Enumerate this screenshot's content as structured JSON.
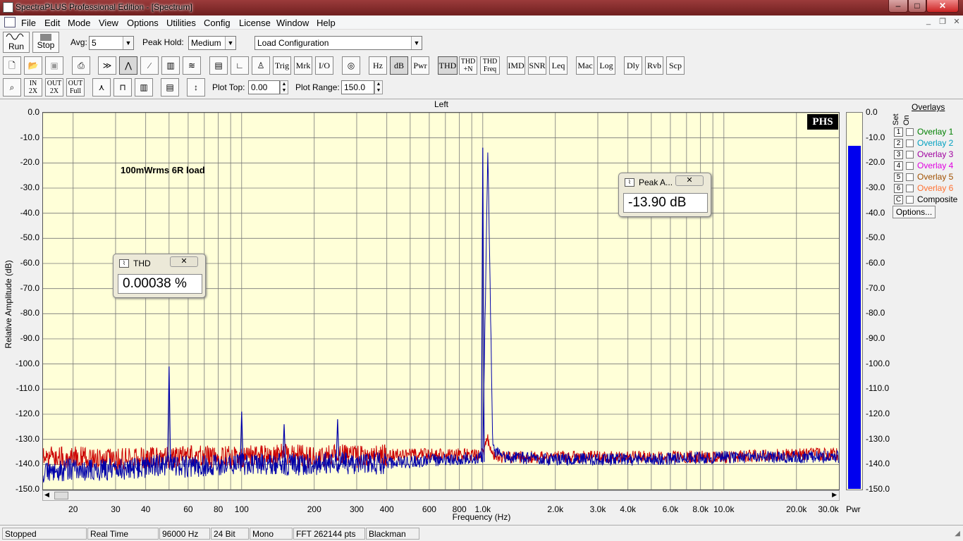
{
  "window": {
    "title": "SpectraPLUS Professional Edition - [Spectrum]",
    "minimize": "–",
    "maximize": "□",
    "close": "✕"
  },
  "menu": [
    "File",
    "Edit",
    "Mode",
    "View",
    "Options",
    "Utilities",
    "Config",
    "License",
    "Window",
    "Help"
  ],
  "controls": {
    "run_label": "Run",
    "stop_label": "Stop",
    "avg_label": "Avg:",
    "avg_value": "5",
    "peakhold_label": "Peak Hold:",
    "peakhold_value": "Medium",
    "config_value": "Load Configuration",
    "plottop_label": "Plot Top:",
    "plottop_value": "0.00",
    "plotrange_label": "Plot Range:",
    "plotrange_value": "150.0"
  },
  "toolbar2": [
    {
      "name": "trig",
      "label": "Trig"
    },
    {
      "name": "mrk",
      "label": "Mrk"
    },
    {
      "name": "io",
      "label": "I/O"
    },
    {
      "name": "hz",
      "label": "Hz"
    },
    {
      "name": "db",
      "label": "dB"
    },
    {
      "name": "pwr",
      "label": "Pwr"
    },
    {
      "name": "thd",
      "label": "THD"
    },
    {
      "name": "thdn",
      "label": "THD +N"
    },
    {
      "name": "thdfreq",
      "label": "THD Freq"
    },
    {
      "name": "imd",
      "label": "IMD"
    },
    {
      "name": "snr",
      "label": "SNR"
    },
    {
      "name": "leq",
      "label": "Leq"
    },
    {
      "name": "mac",
      "label": "Mac"
    },
    {
      "name": "log",
      "label": "Log"
    },
    {
      "name": "dly",
      "label": "Dly"
    },
    {
      "name": "rvb",
      "label": "Rvb"
    },
    {
      "name": "scp",
      "label": "Scp"
    }
  ],
  "toolbar3": [
    {
      "name": "zoom-in-2x",
      "label": "IN 2X"
    },
    {
      "name": "zoom-out-2x",
      "label": "OUT 2X"
    },
    {
      "name": "zoom-out-full",
      "label": "OUT Full"
    }
  ],
  "plot": {
    "channel": "Left",
    "annotation": "100mWrms 6R load",
    "logo": "PHS",
    "ylabel": "Relative Amplitude (dB)",
    "xlabel": "Frequency (Hz)",
    "yticks": [
      "0.0",
      "-10.0",
      "-20.0",
      "-30.0",
      "-40.0",
      "-50.0",
      "-60.0",
      "-70.0",
      "-80.0",
      "-90.0",
      "-100.0",
      "-110.0",
      "-120.0",
      "-130.0",
      "-140.0",
      "-150.0"
    ],
    "xticks": [
      "20",
      "30",
      "40",
      "60",
      "80",
      "100",
      "200",
      "300",
      "400",
      "600",
      "800",
      "1.0k",
      "2.0k",
      "3.0k",
      "4.0k",
      "6.0k",
      "8.0k",
      "10.0k",
      "20.0k",
      "30.0k"
    ],
    "power_ticks": [
      "0.0",
      "-10.0",
      "-20.0",
      "-30.0",
      "-40.0",
      "-50.0",
      "-60.0",
      "-70.0",
      "-80.0",
      "-90.0",
      "-100.0",
      "-110.0",
      "-120.0",
      "-130.0",
      "-140.0",
      "-150.0"
    ],
    "power_label": "Pwr"
  },
  "chart_data": {
    "type": "line",
    "title": "Left",
    "xlabel": "Frequency (Hz)",
    "ylabel": "Relative Amplitude (dB)",
    "xscale": "log",
    "xlim": [
      15,
      30000
    ],
    "ylim": [
      -150,
      0
    ],
    "grid": true,
    "series": [
      {
        "color": "#cc0000",
        "x": [
          15,
          20,
          30,
          50,
          60,
          100,
          150,
          200,
          250,
          300,
          500,
          1000,
          1050,
          1100,
          1200,
          2000,
          3000,
          5000,
          10000,
          20000,
          30000
        ],
        "values": [
          -137,
          -137,
          -138,
          -137,
          -137,
          -137,
          -136,
          -137,
          -136,
          -137,
          -136,
          -136,
          -130,
          -136,
          -137,
          -137,
          -137,
          -137,
          -137,
          -136,
          -136
        ]
      },
      {
        "color": "#0000aa",
        "x": [
          15,
          20,
          30,
          50,
          60,
          100,
          150,
          200,
          250,
          300,
          500,
          1000,
          1050,
          1100,
          1200,
          2000,
          3000,
          5000,
          10000,
          20000,
          30000
        ],
        "values": [
          -143,
          -142,
          -142,
          -140,
          -141,
          -140,
          -140,
          -140,
          -139,
          -140,
          -139,
          -137,
          -14,
          -134,
          -137,
          -138,
          -138,
          -138,
          -137,
          -137,
          -137
        ]
      }
    ],
    "peaks": [
      {
        "x": 50,
        "y": -101
      },
      {
        "x": 100,
        "y": -119
      },
      {
        "x": 150,
        "y": -124
      },
      {
        "x": 250,
        "y": -122
      },
      {
        "x": 1000,
        "y": -13.9
      }
    ],
    "power_level": -13
  },
  "popups": {
    "thd": {
      "title": "THD",
      "value": "0.00038 %"
    },
    "peak": {
      "title": "Peak A...",
      "value": "-13.90 dB"
    }
  },
  "overlays": {
    "title": "Overlays",
    "set_label": "Set",
    "on_label": "On",
    "items": [
      {
        "num": "1",
        "name": "Overlay 1",
        "color": "#008000"
      },
      {
        "num": "2",
        "name": "Overlay 2",
        "color": "#00a0c0"
      },
      {
        "num": "3",
        "name": "Overlay 3",
        "color": "#a000a0"
      },
      {
        "num": "4",
        "name": "Overlay 4",
        "color": "#e000e0"
      },
      {
        "num": "5",
        "name": "Overlay 5",
        "color": "#a05000"
      },
      {
        "num": "6",
        "name": "Overlay 6",
        "color": "#ff7030"
      },
      {
        "num": "C",
        "name": "Composite",
        "color": "#000000"
      }
    ],
    "options_label": "Options..."
  },
  "status": [
    "Stopped",
    "Real Time",
    "96000 Hz",
    "24 Bit",
    "Mono",
    "FFT 262144 pts",
    "Blackman"
  ]
}
